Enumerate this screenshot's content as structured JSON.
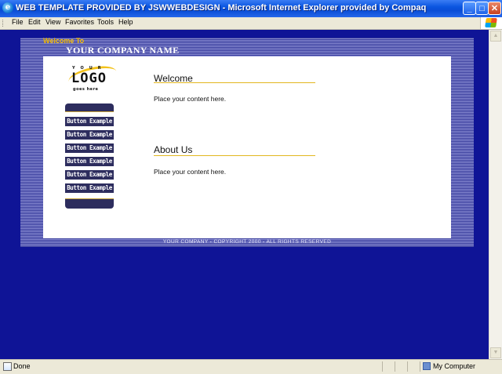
{
  "window": {
    "title": "WEB TEMPLATE PROVIDED BY JSWWEBDESIGN - Microsoft Internet Explorer provided by Compaq",
    "controls": {
      "minimize": "_",
      "maximize": "□",
      "close": "✕"
    }
  },
  "menu": [
    "File",
    "Edit",
    "View",
    "Favorites",
    "Tools",
    "Help"
  ],
  "page": {
    "welcome_to": "Welcome To",
    "company_name": "YOUR COMPANY NAME",
    "logo": {
      "your": "YOUR",
      "main": "LOGO",
      "tagline": "goes here"
    },
    "nav_buttons": [
      "Button Example",
      "Button Example",
      "Button Example",
      "Button Example",
      "Button Example",
      "Button Example"
    ],
    "sections": [
      {
        "heading": "Welcome",
        "text": "Place your content here."
      },
      {
        "heading": "About Us",
        "text": "Place your content here."
      }
    ],
    "footer": "YOUR COMPANY - COPYRIGHT 2000 - ALL RIGHTS RESERVED"
  },
  "status": {
    "text": "Done",
    "zone": "My Computer"
  },
  "colors": {
    "page_bg": "#0f1496",
    "accent": "#e2b71f",
    "nav_bg": "#2d2d5e"
  }
}
